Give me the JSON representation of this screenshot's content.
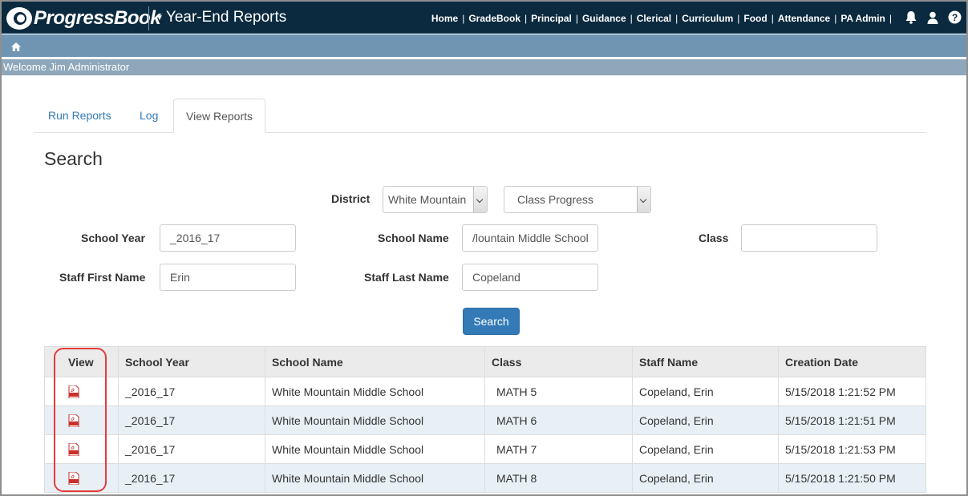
{
  "header": {
    "brand": "ProgressBook",
    "app_title": "Year-End Reports",
    "nav": [
      "Home",
      "GradeBook",
      "Principal",
      "Guidance",
      "Clerical",
      "Curriculum",
      "Food",
      "Attendance",
      "PA Admin"
    ],
    "icons": [
      "bell-icon",
      "user-icon",
      "help-icon"
    ]
  },
  "welcome": "Welcome Jim Administrator",
  "tabs": [
    {
      "label": "Run Reports",
      "active": false
    },
    {
      "label": "Log",
      "active": false
    },
    {
      "label": "View Reports",
      "active": true
    }
  ],
  "search": {
    "title": "Search",
    "district_label": "District",
    "district_value": "White Mountain",
    "report_value": "Class Progress",
    "school_year_label": "School Year",
    "school_year_value": "_2016_17",
    "school_name_label": "School Name",
    "school_name_value": "/lountain Middle School",
    "class_label": "Class",
    "class_value": "",
    "staff_first_label": "Staff First Name",
    "staff_first_value": "Erin",
    "staff_last_label": "Staff Last Name",
    "staff_last_value": "Copeland",
    "button": "Search"
  },
  "table": {
    "headers": [
      "View",
      "School Year",
      "School Name",
      "Class",
      "Staff Name",
      "Creation Date"
    ],
    "rows": [
      {
        "school_year": "_2016_17",
        "school_name": "White Mountain Middle School",
        "class": "MATH 5",
        "staff": "Copeland, Erin",
        "created": "5/15/2018 1:21:52 PM"
      },
      {
        "school_year": "_2016_17",
        "school_name": "White Mountain Middle School",
        "class": "MATH 6",
        "staff": "Copeland, Erin",
        "created": "5/15/2018 1:21:51 PM"
      },
      {
        "school_year": "_2016_17",
        "school_name": "White Mountain Middle School",
        "class": "MATH 7",
        "staff": "Copeland, Erin",
        "created": "5/15/2018 1:21:53 PM"
      },
      {
        "school_year": "_2016_17",
        "school_name": "White Mountain Middle School",
        "class": "MATH 8",
        "staff": "Copeland, Erin",
        "created": "5/15/2018 1:21:50 PM"
      }
    ]
  },
  "colors": {
    "topbar": "#0b2a3f",
    "subbar": "#6f95b3",
    "welcome_bar": "#8ea7ba",
    "primary": "#337ab7",
    "highlight": "#e63b3b",
    "stripe": "#e8f0f6"
  }
}
